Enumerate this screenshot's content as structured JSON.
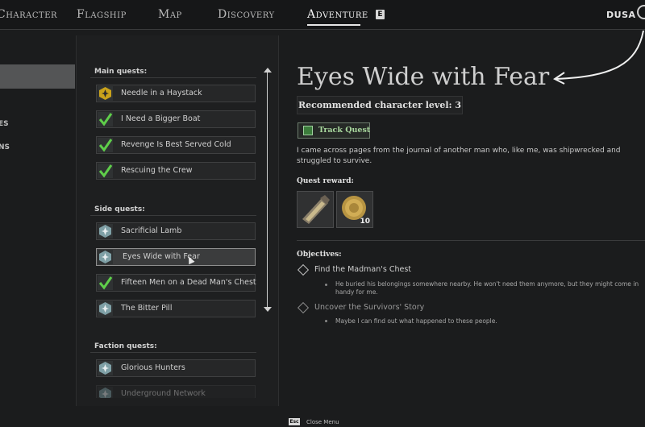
{
  "nav": {
    "tabs": [
      {
        "label": "Character"
      },
      {
        "label": "Flagship"
      },
      {
        "label": "Map"
      },
      {
        "label": "Discovery"
      },
      {
        "label": "Adventure"
      }
    ],
    "active_key": "E",
    "region": "DUSA"
  },
  "left_list": {
    "items": [
      {
        "label": ""
      },
      {
        "label": "ES"
      },
      {
        "label": "NS"
      }
    ]
  },
  "quests": {
    "main_label": "Main quests:",
    "main": [
      {
        "label": "Needle in a Haystack",
        "icon": "active-quest-icon"
      },
      {
        "label": "I Need a Bigger Boat",
        "icon": "completed-check-icon"
      },
      {
        "label": "Revenge Is Best Served Cold",
        "icon": "completed-check-icon"
      },
      {
        "label": "Rescuing the Crew",
        "icon": "completed-check-icon"
      }
    ],
    "side_label": "Side quests:",
    "side": [
      {
        "label": "Sacrificial Lamb",
        "icon": "side-quest-icon"
      },
      {
        "label": "Eyes Wide with Fear",
        "icon": "side-quest-icon"
      },
      {
        "label": "Fifteen Men on a Dead Man's Chest",
        "icon": "completed-check-icon"
      },
      {
        "label": "The Bitter Pill",
        "icon": "side-quest-icon"
      }
    ],
    "faction_label": "Faction quests:",
    "faction": [
      {
        "label": "Glorious Hunters",
        "icon": "side-quest-icon"
      },
      {
        "label": "Underground Network",
        "icon": "side-quest-icon"
      }
    ]
  },
  "details": {
    "title": "Eyes Wide with Fear",
    "recommended_level": "Recommended character level: 3",
    "track_label": "Track Quest",
    "description": "I came across pages from the journal of another man who, like me, was shipwrecked and struggled to survive.",
    "reward_label": "Quest reward:",
    "rewards": [
      {
        "icon": "spyglass-icon",
        "count": ""
      },
      {
        "icon": "gold-coin-icon",
        "count": "10"
      }
    ],
    "objectives_label": "Objectives:",
    "objectives": [
      {
        "title": "Find the Madman's Chest",
        "detail": "He buried his belongings somewhere nearby. He won't need them anymore, but they might come in handy for me."
      },
      {
        "title": "Uncover the Survivors' Story",
        "detail": "Maybe I can find out what happened to these people."
      }
    ]
  },
  "footer": {
    "key": "Esc",
    "label": "Close Menu"
  },
  "colors": {
    "background": "#1b1c1d",
    "accent_green": "#3c7d3c",
    "highlight": "#8f8f8f"
  }
}
